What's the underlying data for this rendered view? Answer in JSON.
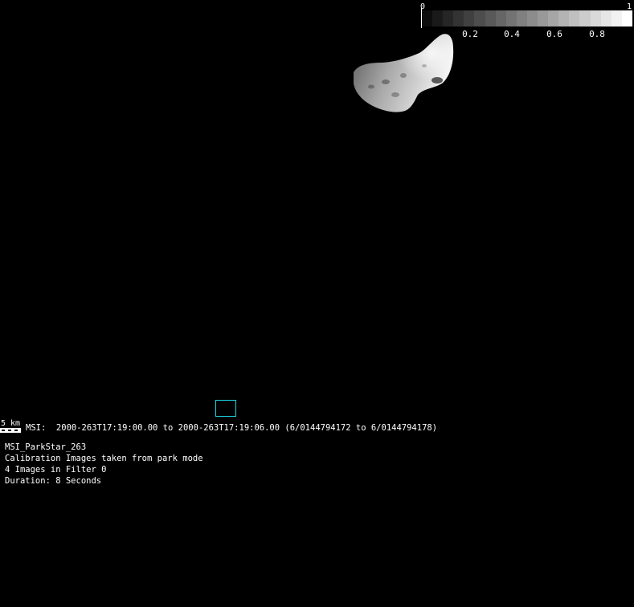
{
  "colorbar": {
    "min_label": "0",
    "max_label": "1",
    "tick_labels": [
      "0.2",
      "0.4",
      "0.6",
      "0.8"
    ],
    "tick_values": [
      0.2,
      0.4,
      0.6,
      0.8
    ],
    "steps": 20
  },
  "scale": {
    "label": "5 km"
  },
  "caption": {
    "instrument_line": "MSI:  2000-263T17:19:00.00 to 2000-263T17:19:06.00 (6/0144794172 to 6/0144794178)"
  },
  "info": {
    "lines": [
      "MSI_ParkStar_263",
      "Calibration Images taken from park mode",
      "4 Images in Filter 0",
      "Duration: 8 Seconds"
    ]
  },
  "colors": {
    "background": "#000000",
    "footprint_outline": "#1fd6e6"
  }
}
